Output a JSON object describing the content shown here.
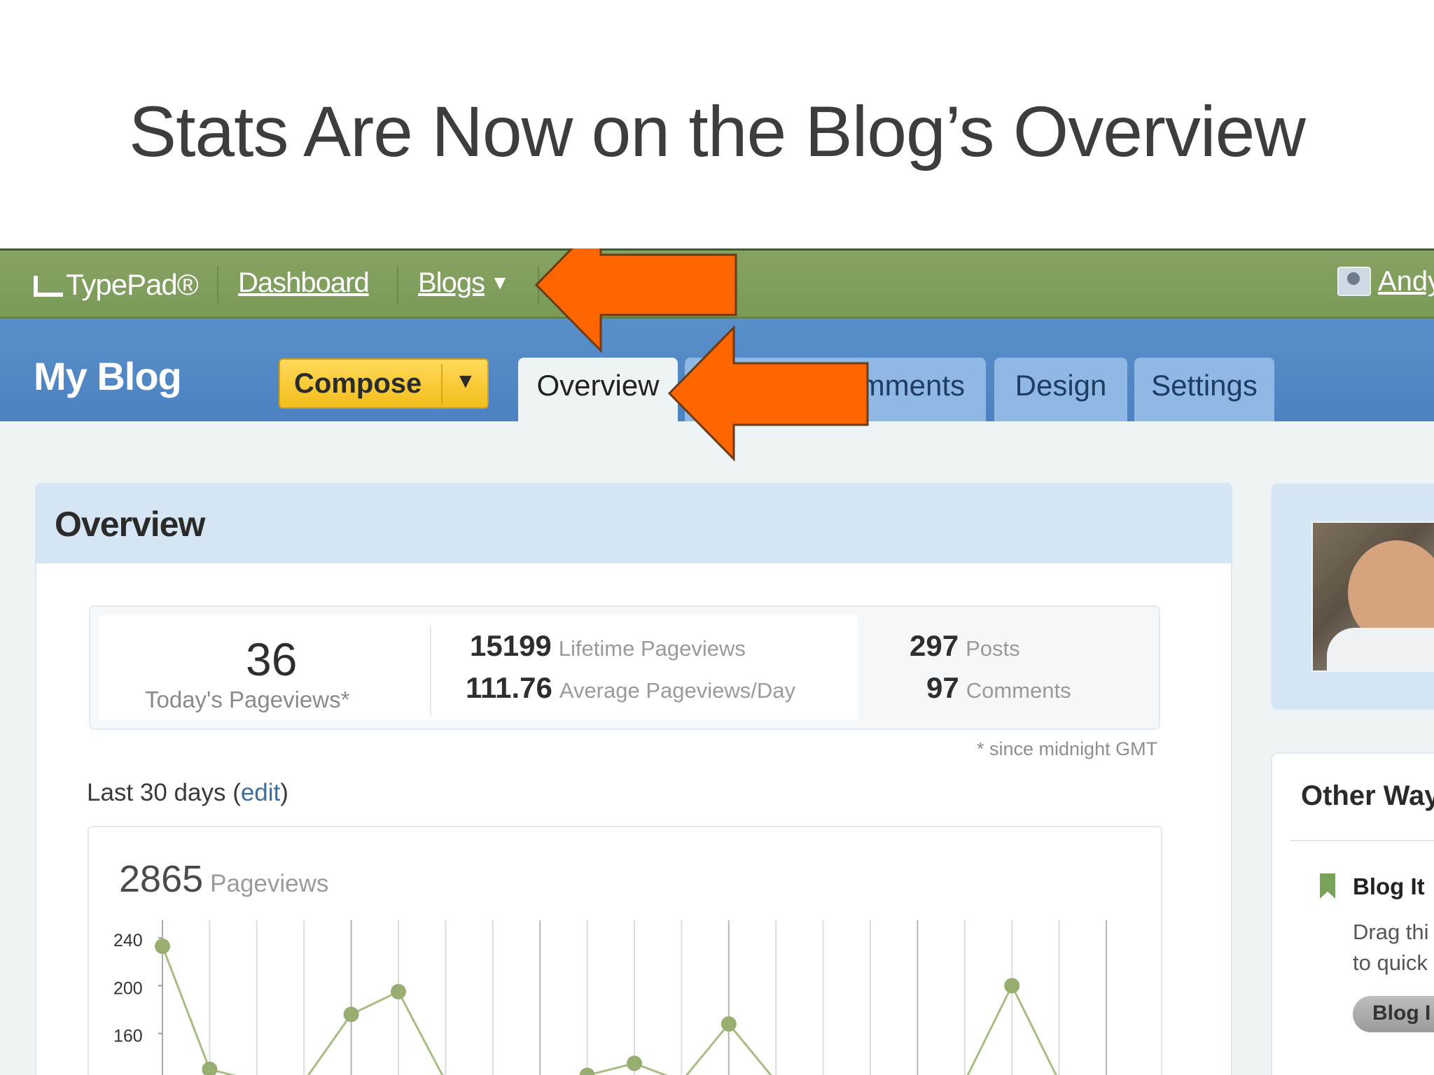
{
  "slide_title": "Stats Are Now on the Blog’s Overview",
  "topbar": {
    "logo": "TypePad®",
    "links": [
      "Dashboard",
      "Blogs"
    ],
    "blogs_caret": "▼",
    "user_partial": "Andy"
  },
  "blog_bar": {
    "blog_name": "My Blog",
    "compose_label": "Compose",
    "compose_caret": "▼",
    "tabs": [
      "Overview",
      "Comments",
      "Design",
      "Settings"
    ],
    "visible_tab_text": [
      "Overview",
      "mments",
      "Design",
      "Settings"
    ],
    "active_tab": "Overview"
  },
  "overview": {
    "heading": "Overview",
    "today": {
      "value": "36",
      "label": "Today's Pageviews*"
    },
    "lifetime": {
      "value": "15199",
      "label": "Lifetime Pageviews"
    },
    "average": {
      "value": "111.76",
      "label": "Average Pageviews/Day"
    },
    "posts": {
      "value": "297",
      "label": "Posts"
    },
    "comments": {
      "value": "97",
      "label": "Comments"
    },
    "note": "* since midnight GMT",
    "range_label": "Last 30 days (",
    "edit_label": "edit",
    "range_close": ")"
  },
  "chart_data": {
    "type": "line",
    "title": "2865",
    "subtitle": "Pageviews",
    "yticks": [
      "240",
      "200",
      "160"
    ],
    "ylim": [
      120,
      250
    ],
    "x": [
      1,
      2,
      3,
      4,
      5,
      6,
      7,
      8,
      9,
      10,
      11,
      12,
      13,
      14,
      15,
      16,
      17,
      18,
      19,
      20,
      21
    ],
    "values": [
      233,
      130,
      120,
      120,
      176,
      195,
      120,
      120,
      120,
      125,
      135,
      120,
      168,
      120,
      120,
      120,
      120,
      120,
      200,
      120,
      120
    ],
    "point_color": "#98ad70",
    "line_color": "#a8bd84"
  },
  "sidebar": {
    "other_ways": "Other Way",
    "blog_it_title": "Blog It",
    "blog_it_desc": [
      "Drag thi",
      "to quick"
    ],
    "blog_it_button": "Blog I"
  },
  "colors": {
    "topbar": "#7a9a58",
    "bluebar": "#4c82c1",
    "arrow": "#ff6600",
    "compose": "#f3be1c"
  },
  "icons": [
    "typepad-logo-icon",
    "chevron-down-icon",
    "user-avatar-icon",
    "bookmark-icon",
    "arrow-left-icon"
  ]
}
